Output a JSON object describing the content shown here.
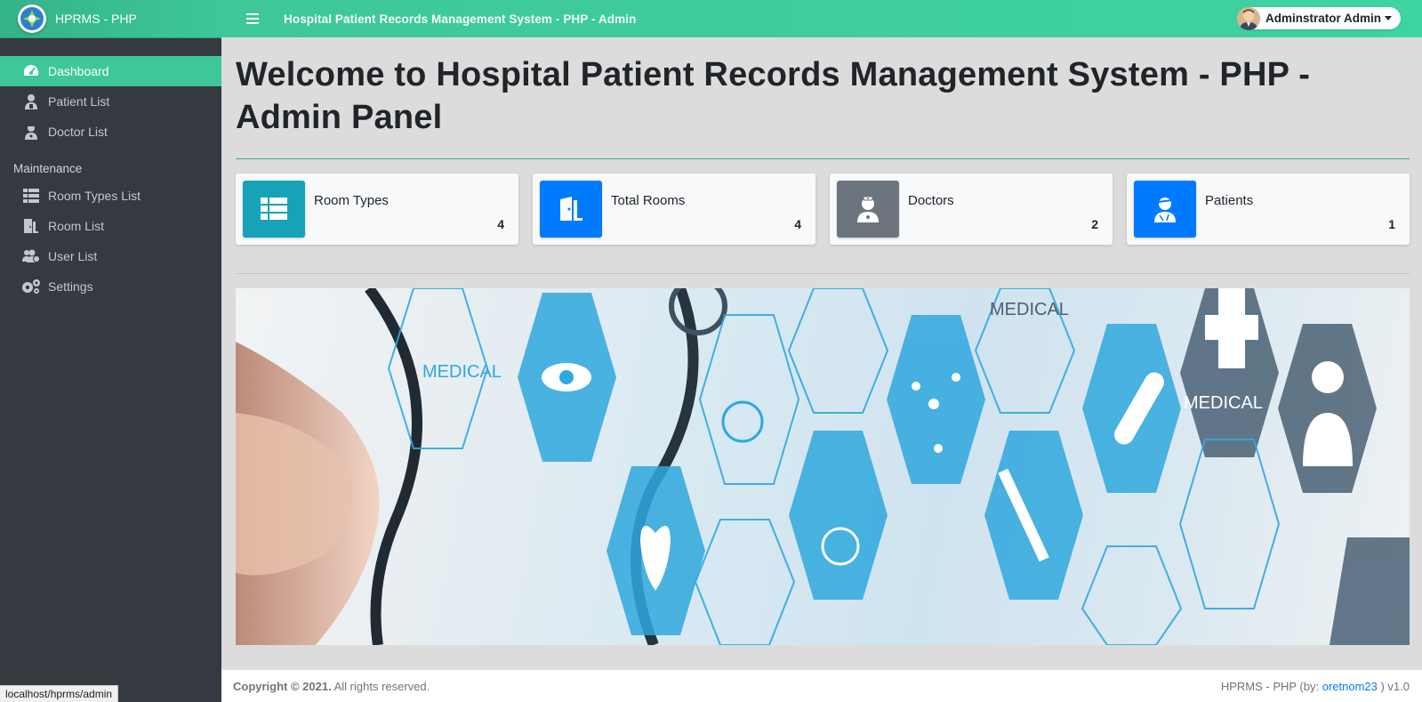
{
  "app": {
    "brand_name": "HPRMS - PHP",
    "top_title": "Hospital Patient Records Management System - PHP - Admin",
    "user_name": "Adminstrator Admin"
  },
  "sidebar": {
    "items": [
      {
        "label": "Dashboard",
        "icon": "dashboard-gauge-icon",
        "active": true
      },
      {
        "label": "Patient List",
        "icon": "patient-icon"
      },
      {
        "label": "Doctor List",
        "icon": "doctor-icon"
      }
    ],
    "maintenance_header": "Maintenance",
    "maintenance_items": [
      {
        "label": "Room Types List",
        "icon": "table-list-icon"
      },
      {
        "label": "Room List",
        "icon": "door-icon"
      },
      {
        "label": "User List",
        "icon": "users-icon"
      },
      {
        "label": "Settings",
        "icon": "cogs-icon"
      }
    ]
  },
  "main": {
    "welcome": "Welcome to Hospital Patient Records Management System - PHP - Admin Panel",
    "cards": [
      {
        "label": "Room Types",
        "value": "4",
        "icon": "table-list-icon",
        "color": "#17a2b8"
      },
      {
        "label": "Total Rooms",
        "value": "4",
        "icon": "door-open-icon",
        "color": "#007bff"
      },
      {
        "label": "Doctors",
        "value": "2",
        "icon": "doctor-icon",
        "color": "#6c757d"
      },
      {
        "label": "Patients",
        "value": "1",
        "icon": "patient-injured-icon",
        "color": "#007bff"
      }
    ],
    "banner_texts": [
      "MEDICAL",
      "MEDICAL",
      "MEDICAL"
    ]
  },
  "footer": {
    "copyright": "Copyright © 2021.",
    "rights": "All rights reserved.",
    "credit_prefix": "HPRMS - PHP (by: ",
    "credit_link": "oretnom23",
    "credit_suffix": " ) v1.0"
  },
  "status_bar": {
    "url": "localhost/hprms/admin"
  },
  "colors": {
    "accent": "#3ec79a",
    "sidebar_bg": "#343a40",
    "link": "#007bff"
  }
}
